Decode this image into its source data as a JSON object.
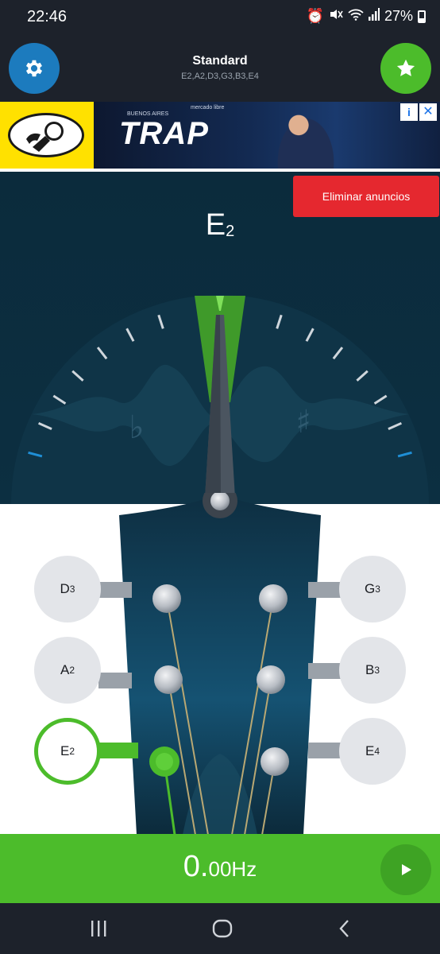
{
  "status_bar": {
    "time": "22:46",
    "battery": "27%",
    "icons": [
      "alarm-icon",
      "mute-icon",
      "wifi-icon",
      "signal-icon",
      "battery-icon"
    ]
  },
  "header": {
    "title": "Standard",
    "notes": "E2,A2,D3,G3,B3,E4",
    "settings_icon": "gear-icon",
    "favorite_icon": "star-icon"
  },
  "ad": {
    "headline": "TRAP",
    "subline": "BUENOS AIRES",
    "brand": "mercado libre",
    "info_icon": "info-icon",
    "close_icon": "close-icon"
  },
  "remove_ads_label": "Eliminar anuncios",
  "tuner": {
    "note_letter": "E",
    "note_octave": "2",
    "flat_symbol": "♭",
    "sharp_symbol": "♯"
  },
  "pegs": {
    "left": [
      {
        "letter": "D",
        "octave": "3",
        "active": false
      },
      {
        "letter": "A",
        "octave": "2",
        "active": false
      },
      {
        "letter": "E",
        "octave": "2",
        "active": true
      }
    ],
    "right": [
      {
        "letter": "G",
        "octave": "3",
        "active": false
      },
      {
        "letter": "B",
        "octave": "3",
        "active": false
      },
      {
        "letter": "E",
        "octave": "4",
        "active": false
      }
    ]
  },
  "frequency": {
    "integer": "0.",
    "decimals": "00",
    "unit": "Hz",
    "play_icon": "play-icon"
  },
  "navbar": {
    "recents_icon": "recents-icon",
    "home_icon": "home-icon",
    "back_icon": "back-icon"
  },
  "colors": {
    "accent_green": "#4cbc2b",
    "settings_blue": "#1c7bbe",
    "remove_ads_red": "#e5282f",
    "tuner_bg": "#0b2b3c"
  }
}
